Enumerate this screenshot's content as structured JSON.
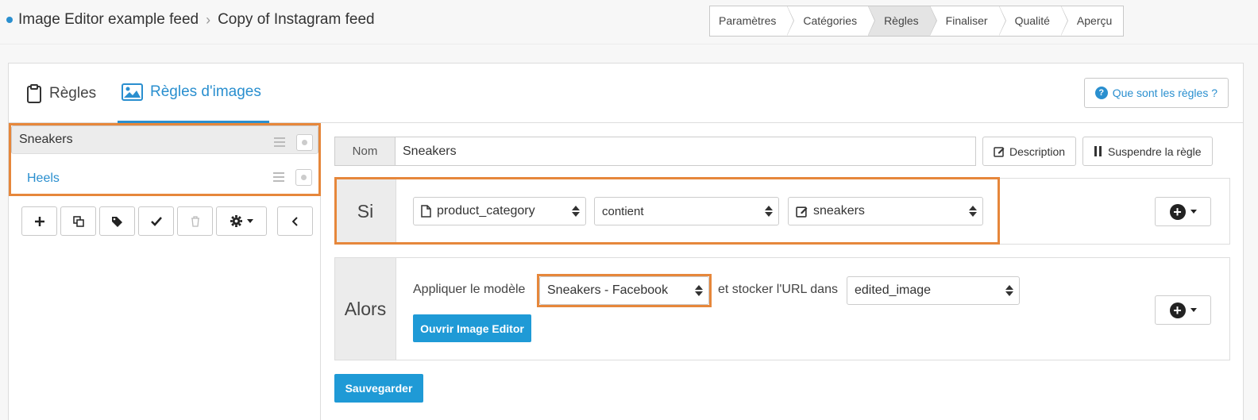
{
  "breadcrumb": {
    "items": [
      "Image Editor example feed",
      "Copy of Instagram feed"
    ]
  },
  "steps": [
    "Paramètres",
    "Catégories",
    "Règles",
    "Finaliser",
    "Qualité",
    "Aperçu"
  ],
  "active_step": "Règles",
  "tabs": {
    "rules": "Règles",
    "image_rules": "Règles d'images"
  },
  "help_button": "Que sont les règles ?",
  "rules_list": [
    {
      "label": "Sneakers"
    },
    {
      "label": "Heels"
    }
  ],
  "rule": {
    "name_label": "Nom",
    "name_value": "Sneakers",
    "description_button": "Description",
    "suspend_button": "Suspendre la règle"
  },
  "condition": {
    "label": "Si",
    "field": "product_category",
    "operator": "contient",
    "value": "sneakers"
  },
  "action": {
    "label": "Alors",
    "apply_text": "Appliquer le modèle",
    "template": "Sneakers - Facebook",
    "store_text": "et stocker l'URL dans",
    "target_field": "edited_image",
    "open_editor_button": "Ouvrir Image Editor"
  },
  "save_button": "Sauvegarder",
  "colors": {
    "accent": "#2a8fcf",
    "primary_button": "#1f9ad6",
    "highlight": "#e6873b"
  }
}
